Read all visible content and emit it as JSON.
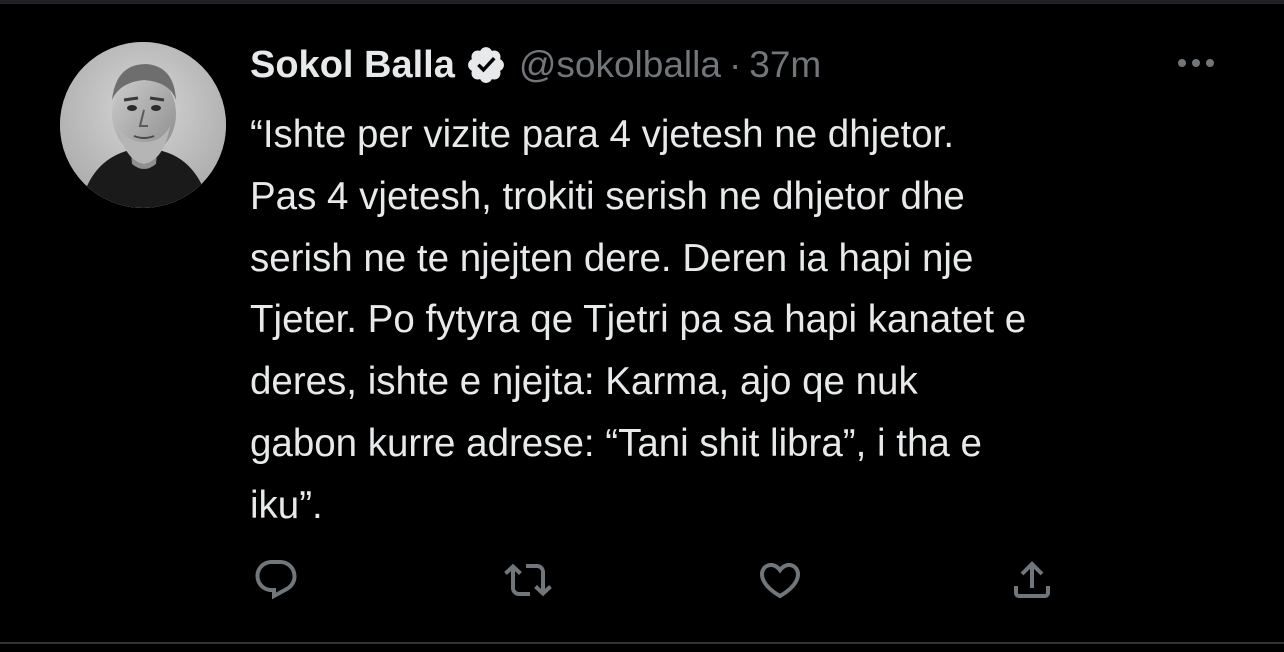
{
  "tweet": {
    "author": {
      "display_name": "Sokol Balla",
      "handle": "@sokolballa",
      "verified": true,
      "avatar": "avatar-photo"
    },
    "separator": "·",
    "timestamp": "37m",
    "more_icon": "more-icon",
    "text_lines": [
      "“Ishte per vizite para 4 vjetesh ne dhjetor.",
      "Pas 4 vjetesh, trokiti serish ne dhjetor dhe",
      "serish ne te njejten dere. Deren ia hapi nje",
      "Tjeter. Po fytyra qe Tjetri pa sa hapi kanatet e",
      "deres, ishte e njejta: Karma, ajo qe nuk",
      "gabon kurre adrese: “Tani shit libra”, i tha e",
      "iku”."
    ],
    "actions": [
      {
        "name": "reply",
        "icon": "reply-icon"
      },
      {
        "name": "retweet",
        "icon": "retweet-icon"
      },
      {
        "name": "like",
        "icon": "heart-icon"
      },
      {
        "name": "share",
        "icon": "share-icon"
      }
    ]
  },
  "colors": {
    "background": "#000000",
    "primary_text": "#e7e9ea",
    "secondary_text": "#71767b",
    "divider": "#2f3336"
  }
}
